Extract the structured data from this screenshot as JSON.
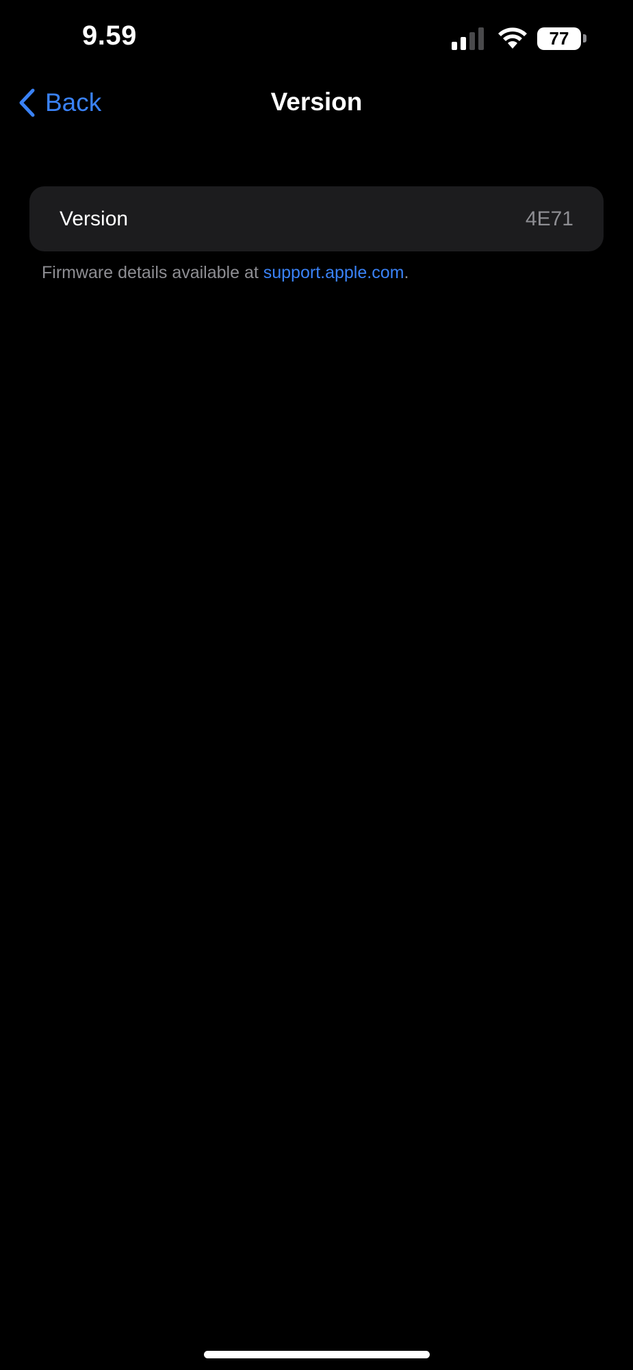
{
  "status_bar": {
    "time": "9.59",
    "battery_level": "77",
    "signal_icon": "cellular-signal-icon",
    "wifi_icon": "wifi-icon",
    "battery_icon": "battery-icon"
  },
  "nav": {
    "back_label": "Back",
    "back_icon": "chevron-left-icon",
    "title": "Version"
  },
  "list": {
    "rows": [
      {
        "label": "Version",
        "value": "4E71"
      }
    ]
  },
  "footer": {
    "text_prefix": "Firmware details available at ",
    "link_text": "support.apple.com",
    "text_suffix": "."
  },
  "colors": {
    "background": "#000000",
    "cell_background": "#1c1c1e",
    "accent": "#3a82f7",
    "secondary_text": "#8e8e93",
    "primary_text": "#ffffff"
  }
}
